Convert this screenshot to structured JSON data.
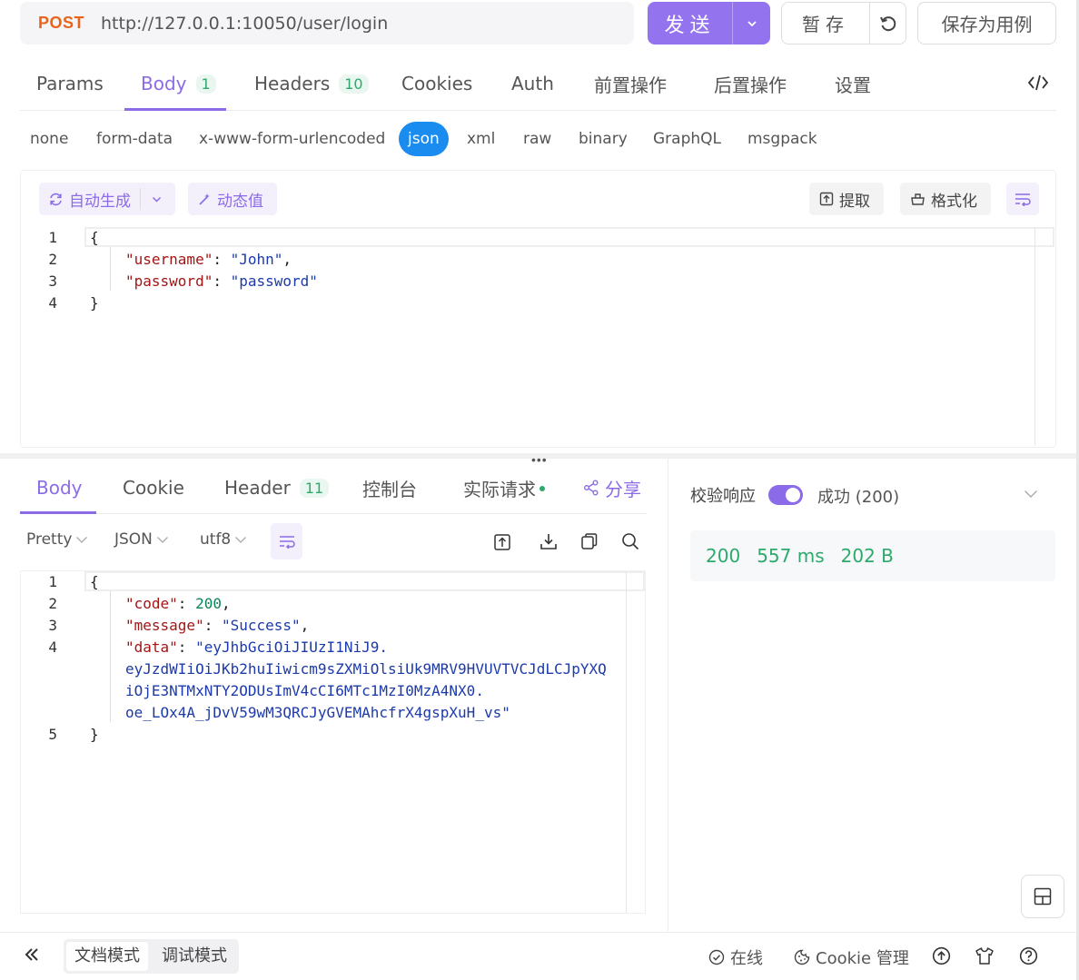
{
  "request": {
    "method": "POST",
    "url": "http://127.0.0.1:10050/user/login",
    "send_label": "发送",
    "save_label": "暂存",
    "save_as_case_label": "保存为用例"
  },
  "tabs": [
    {
      "label": "Params",
      "badge": ""
    },
    {
      "label": "Body",
      "badge": "1"
    },
    {
      "label": "Headers",
      "badge": "10"
    },
    {
      "label": "Cookies",
      "badge": ""
    },
    {
      "label": "Auth",
      "badge": ""
    },
    {
      "label": "前置操作",
      "badge": ""
    },
    {
      "label": "后置操作",
      "badge": ""
    },
    {
      "label": "设置",
      "badge": ""
    }
  ],
  "active_tab": "Body",
  "body_types": [
    "none",
    "form-data",
    "x-www-form-urlencoded",
    "json",
    "xml",
    "raw",
    "binary",
    "GraphQL",
    "msgpack"
  ],
  "active_body_type": "json",
  "editor_toolbar": {
    "auto_generate": "自动生成",
    "dynamic_value": "动态值",
    "extract": "提取",
    "format": "格式化"
  },
  "request_body": {
    "line_numbers": [
      "1",
      "2",
      "3",
      "4"
    ],
    "lines": [
      {
        "open": "{"
      },
      {
        "key": "\"username\"",
        "sep": ": ",
        "value": "\"John\"",
        "end": ","
      },
      {
        "key": "\"password\"",
        "sep": ": ",
        "value": "\"password\"",
        "end": ""
      },
      {
        "open": "}"
      }
    ]
  },
  "response_tabs": [
    {
      "label": "Body",
      "badge": ""
    },
    {
      "label": "Cookie",
      "badge": ""
    },
    {
      "label": "Header",
      "badge": "11"
    },
    {
      "label": "控制台",
      "badge": ""
    },
    {
      "label": "实际请求",
      "badge": ""
    },
    {
      "label": "分享",
      "badge": ""
    }
  ],
  "response_toolbar": {
    "view": "Pretty",
    "format": "JSON",
    "encoding": "utf8"
  },
  "response_body": {
    "line_numbers": [
      "1",
      "2",
      "3",
      "4",
      "5"
    ],
    "open": "{",
    "code_key": "\"code\"",
    "code_value": "200",
    "message_key": "\"message\"",
    "message_value": "\"Success\"",
    "data_key": "\"data\"",
    "data_line1": "\"eyJhbGciOiJIUzI1NiJ9.",
    "data_line2": "eyJzdWIiOiJKb2huIiwicm9sZXMiOlsiUk9MRV9HVUVTVCJdLCJpYXQ",
    "data_line3": "iOjE3NTMxNTY2ODUsImV4cCI6MTc1MzI0MzA4NX0.",
    "data_line4": "oe_LOx4A_jDvV59wM3QRCJyGVEMAhcfrX4gspXuH_vs\"",
    "close": "}"
  },
  "validation": {
    "label": "校验响应",
    "status": "成功 (200)",
    "enabled": true
  },
  "metrics": {
    "status_code": "200",
    "time": "557 ms",
    "size": "202 B"
  },
  "footer": {
    "doc_mode": "文档模式",
    "debug_mode": "调试模式",
    "online": "在线",
    "cookie_manager": "Cookie 管理"
  },
  "colors": {
    "accent": "#8b6be7",
    "method": "#e8641b",
    "success": "#2daa6b",
    "json_type_active": "#1a8cf0"
  }
}
